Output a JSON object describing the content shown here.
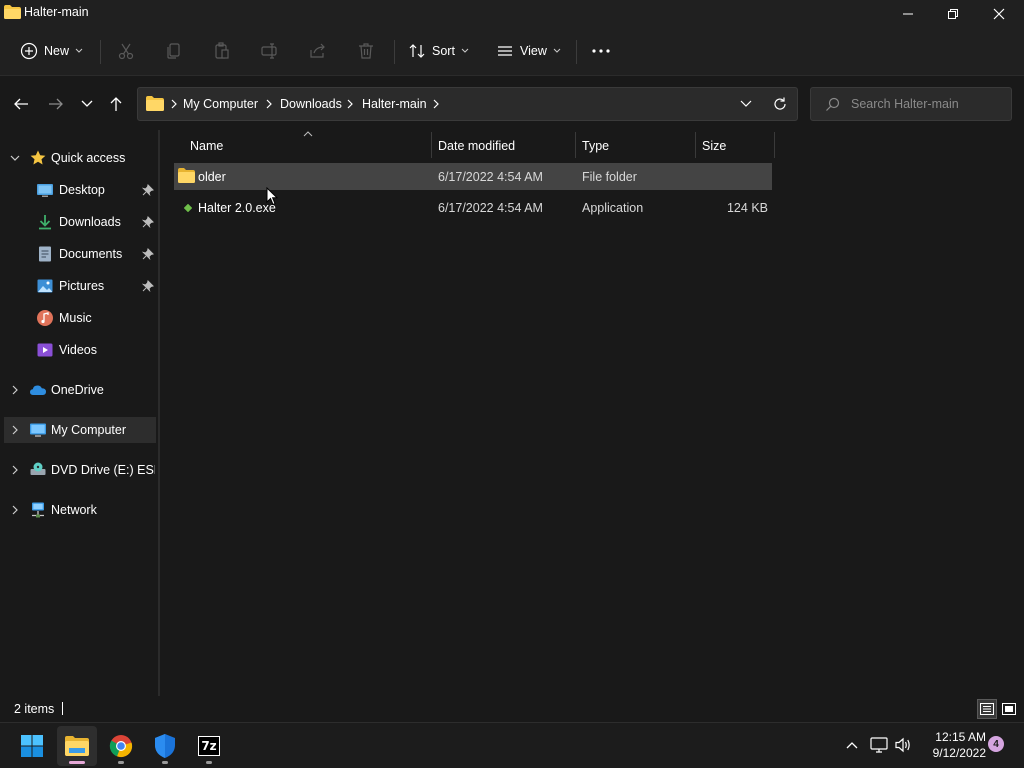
{
  "window": {
    "title": "Halter-main"
  },
  "toolbar": {
    "new_label": "New",
    "sort_label": "Sort",
    "view_label": "View",
    "icons": [
      "cut-icon",
      "copy-icon",
      "paste-icon",
      "rename-icon",
      "share-icon",
      "delete-icon"
    ]
  },
  "address": {
    "crumbs": [
      "My Computer",
      "Downloads",
      "Halter-main"
    ]
  },
  "search": {
    "placeholder": "Search Halter-main"
  },
  "sidebar": {
    "items": [
      {
        "label": "Quick access",
        "icon": "star-icon",
        "pinned": false
      },
      {
        "label": "Desktop",
        "icon": "desktop-icon",
        "pinned": true
      },
      {
        "label": "Downloads",
        "icon": "download-icon",
        "pinned": true
      },
      {
        "label": "Documents",
        "icon": "documents-icon",
        "pinned": true
      },
      {
        "label": "Pictures",
        "icon": "pictures-icon",
        "pinned": true
      },
      {
        "label": "Music",
        "icon": "music-icon",
        "pinned": false
      },
      {
        "label": "Videos",
        "icon": "videos-icon",
        "pinned": false
      },
      {
        "label": "OneDrive",
        "icon": "cloud-icon",
        "pinned": false
      },
      {
        "label": "My Computer",
        "icon": "computer-icon",
        "pinned": false,
        "selected": true
      },
      {
        "label": "DVD Drive (E:) ESD-ISO",
        "icon": "dvd-drive-icon",
        "pinned": false
      },
      {
        "label": "Network",
        "icon": "network-icon",
        "pinned": false
      }
    ]
  },
  "file_list": {
    "columns": [
      "Name",
      "Date modified",
      "Type",
      "Size"
    ],
    "rows": [
      {
        "name": "older",
        "date": "6/17/2022 4:54 AM",
        "type": "File folder",
        "size": "",
        "icon": "folder-icon",
        "selected": true
      },
      {
        "name": "Halter 2.0.exe",
        "date": "6/17/2022 4:54 AM",
        "type": "Application",
        "size": "124 KB",
        "icon": "application-icon",
        "selected": false
      }
    ]
  },
  "status": {
    "item_count": "2 items"
  },
  "taskbar": {
    "apps": [
      "start-icon",
      "file-explorer-icon",
      "chrome-icon",
      "defender-icon",
      "7zip-icon"
    ],
    "sevenzip_label": "7z",
    "time": "12:15 AM",
    "date": "9/12/2022",
    "notification_count": "4"
  },
  "colors": {
    "background": "#191919",
    "chrome": "#202020",
    "selection": "#444444",
    "folder_yellow": "#f5c542",
    "accent": "#4cc2ff"
  }
}
